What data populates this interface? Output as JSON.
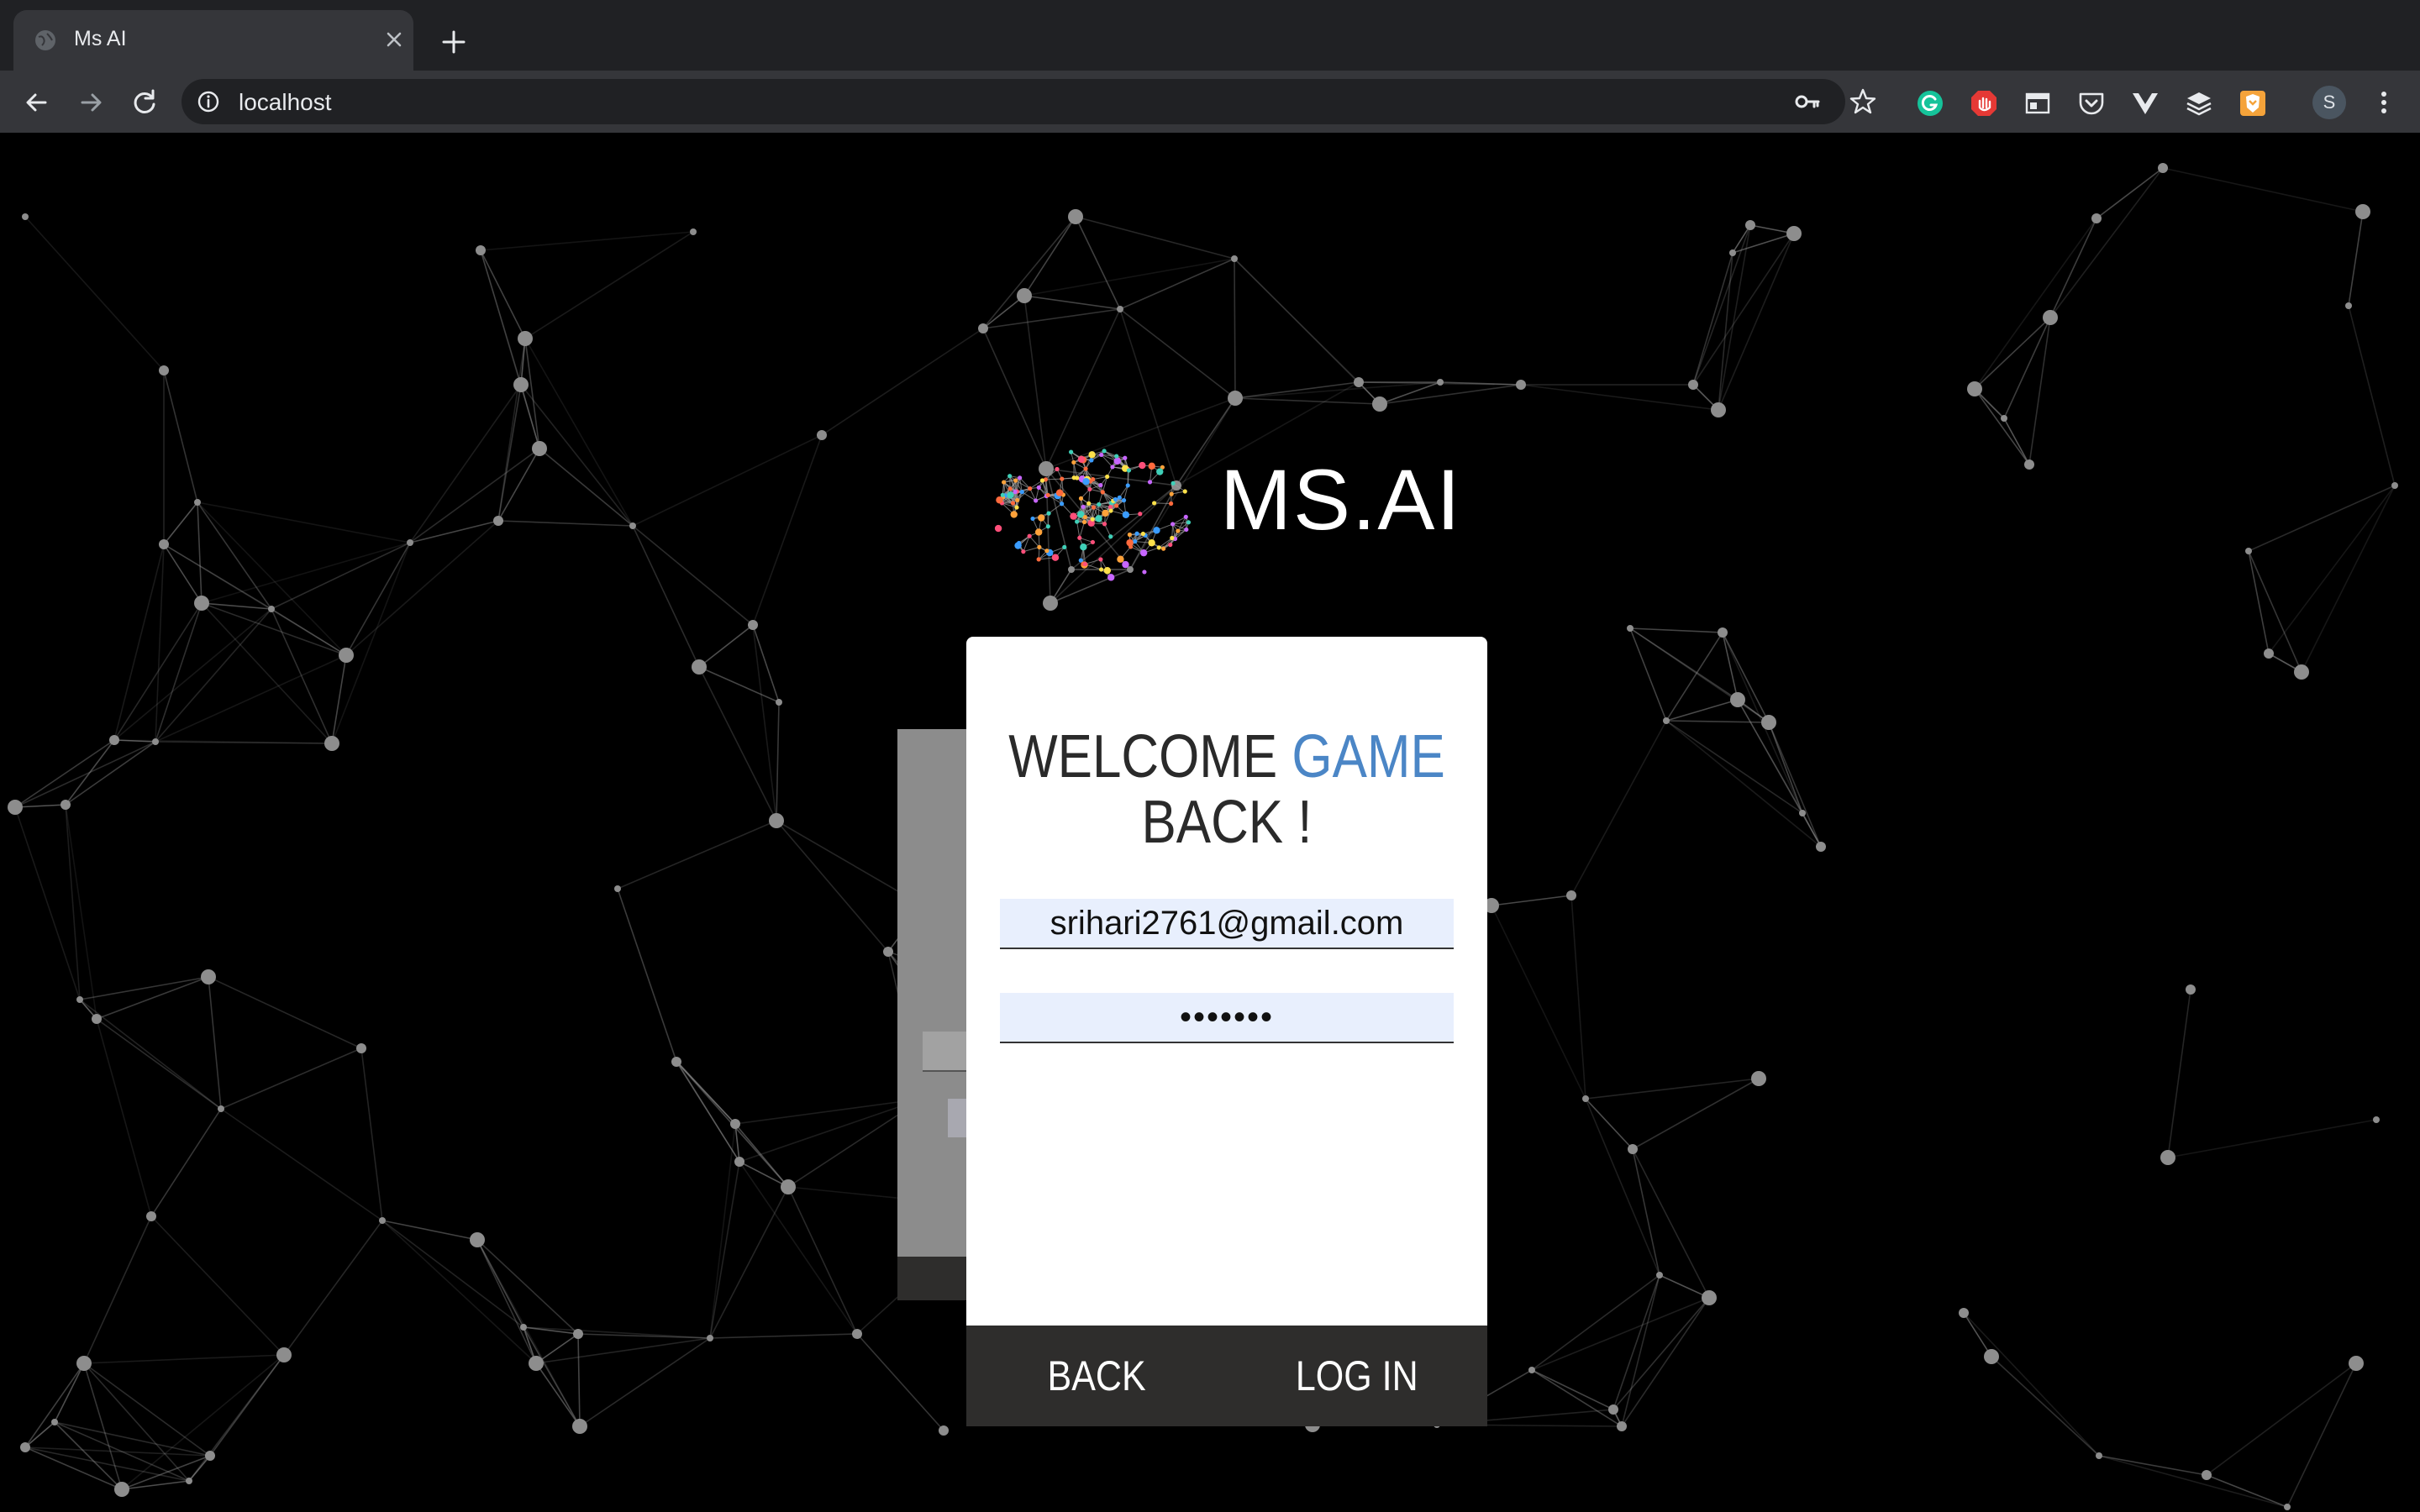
{
  "browser": {
    "tab_title": "Ms AI",
    "url": "localhost",
    "profile_initial": "S"
  },
  "brand": {
    "name": "MS.AI"
  },
  "login": {
    "welcome_line1_part1": "WELCOME",
    "welcome_line1_part2": "GAME",
    "welcome_line2": "BACK !",
    "email_value": "srihari2761@gmail.com",
    "password_value": "•••••••",
    "back_label": "BACK",
    "login_label": "LOG IN"
  },
  "colors": {
    "accent": "#4b86c6",
    "card_footer": "#2e2d2c",
    "input_fill": "#e8effd",
    "page_background": "#000000"
  },
  "icons": {
    "tab": "globe-icon",
    "close": "close-icon",
    "new_tab": "plus-icon",
    "back": "arrow-left-icon",
    "forward": "arrow-right-icon",
    "reload": "reload-icon",
    "info": "info-icon",
    "key": "key-icon",
    "star": "star-icon",
    "menu": "kebab-menu-icon"
  }
}
